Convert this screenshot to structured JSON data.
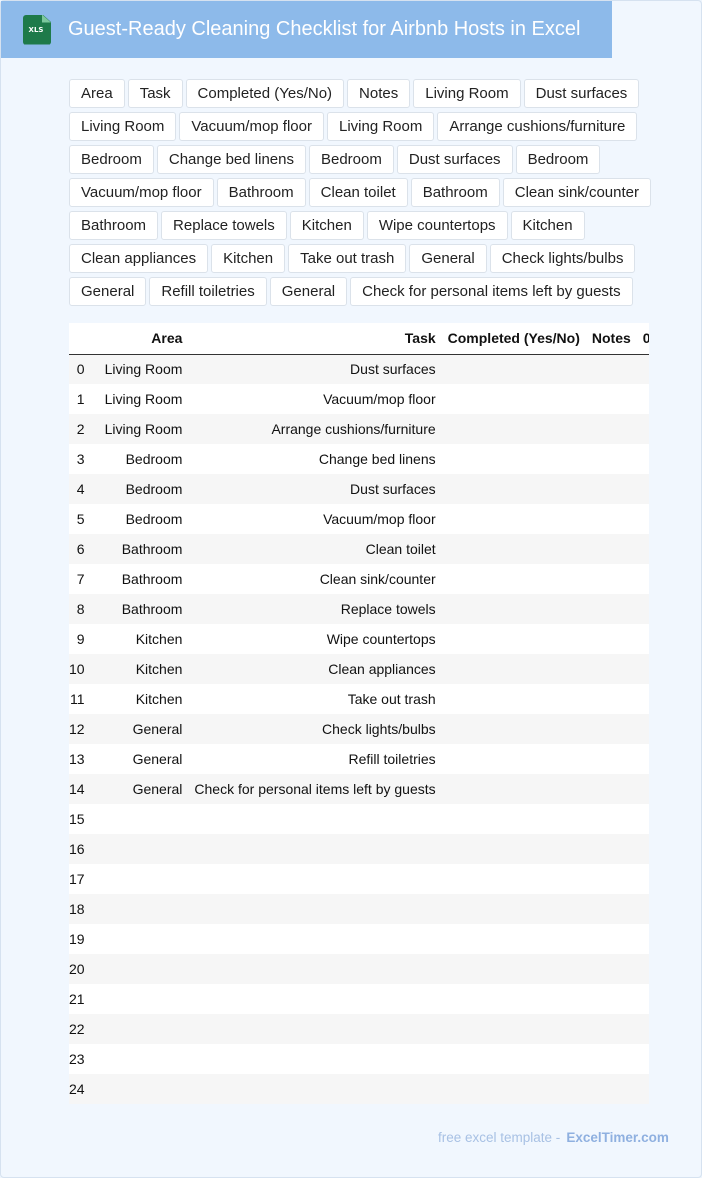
{
  "header": {
    "title": "Guest-Ready Cleaning Checklist for Airbnb Hosts in Excel",
    "icon": "excel-file-icon",
    "icon_label": "XLS"
  },
  "chips": [
    "Area",
    "Task",
    "Completed (Yes/No)",
    "Notes",
    "Living Room",
    "Dust surfaces",
    "Living Room",
    "Vacuum/mop floor",
    "Living Room",
    "Arrange cushions/furniture",
    "Bedroom",
    "Change bed linens",
    "Bedroom",
    "Dust surfaces",
    "Bedroom",
    "Vacuum/mop floor",
    "Bathroom",
    "Clean toilet",
    "Bathroom",
    "Clean sink/counter",
    "Bathroom",
    "Replace towels",
    "Kitchen",
    "Wipe countertops",
    "Kitchen",
    "Clean appliances",
    "Kitchen",
    "Take out trash",
    "General",
    "Check lights/bulbs",
    "General",
    "Refill toiletries",
    "General",
    "Check for personal items left by guests"
  ],
  "table": {
    "headers": {
      "index": "",
      "area": "Area",
      "task": "Task",
      "completed": "Completed (Yes/No)",
      "notes": "Notes",
      "zero": "0"
    },
    "rows": [
      {
        "index": "0",
        "area": "Living Room",
        "task": "Dust surfaces",
        "completed": "",
        "notes": ""
      },
      {
        "index": "1",
        "area": "Living Room",
        "task": "Vacuum/mop floor",
        "completed": "",
        "notes": ""
      },
      {
        "index": "2",
        "area": "Living Room",
        "task": "Arrange cushions/furniture",
        "completed": "",
        "notes": ""
      },
      {
        "index": "3",
        "area": "Bedroom",
        "task": "Change bed linens",
        "completed": "",
        "notes": ""
      },
      {
        "index": "4",
        "area": "Bedroom",
        "task": "Dust surfaces",
        "completed": "",
        "notes": ""
      },
      {
        "index": "5",
        "area": "Bedroom",
        "task": "Vacuum/mop floor",
        "completed": "",
        "notes": ""
      },
      {
        "index": "6",
        "area": "Bathroom",
        "task": "Clean toilet",
        "completed": "",
        "notes": ""
      },
      {
        "index": "7",
        "area": "Bathroom",
        "task": "Clean sink/counter",
        "completed": "",
        "notes": ""
      },
      {
        "index": "8",
        "area": "Bathroom",
        "task": "Replace towels",
        "completed": "",
        "notes": ""
      },
      {
        "index": "9",
        "area": "Kitchen",
        "task": "Wipe countertops",
        "completed": "",
        "notes": ""
      },
      {
        "index": "10",
        "area": "Kitchen",
        "task": "Clean appliances",
        "completed": "",
        "notes": ""
      },
      {
        "index": "11",
        "area": "Kitchen",
        "task": "Take out trash",
        "completed": "",
        "notes": ""
      },
      {
        "index": "12",
        "area": "General",
        "task": "Check lights/bulbs",
        "completed": "",
        "notes": ""
      },
      {
        "index": "13",
        "area": "General",
        "task": "Refill toiletries",
        "completed": "",
        "notes": ""
      },
      {
        "index": "14",
        "area": "General",
        "task": "Check for personal items left by guests",
        "completed": "",
        "notes": ""
      },
      {
        "index": "15",
        "area": "",
        "task": "",
        "completed": "",
        "notes": ""
      },
      {
        "index": "16",
        "area": "",
        "task": "",
        "completed": "",
        "notes": ""
      },
      {
        "index": "17",
        "area": "",
        "task": "",
        "completed": "",
        "notes": ""
      },
      {
        "index": "18",
        "area": "",
        "task": "",
        "completed": "",
        "notes": ""
      },
      {
        "index": "19",
        "area": "",
        "task": "",
        "completed": "",
        "notes": ""
      },
      {
        "index": "20",
        "area": "",
        "task": "",
        "completed": "",
        "notes": ""
      },
      {
        "index": "21",
        "area": "",
        "task": "",
        "completed": "",
        "notes": ""
      },
      {
        "index": "22",
        "area": "",
        "task": "",
        "completed": "",
        "notes": ""
      },
      {
        "index": "23",
        "area": "",
        "task": "",
        "completed": "",
        "notes": ""
      },
      {
        "index": "24",
        "area": "",
        "task": "",
        "completed": "",
        "notes": ""
      }
    ]
  },
  "footer": {
    "prefix": "free excel template -",
    "brand": "ExcelTimer.com"
  },
  "colors": {
    "header_bg": "#8dbaea",
    "page_bg": "#f1f7fe",
    "excel_green": "#1e7a4a",
    "brand_blue": "#8fb0e0"
  }
}
